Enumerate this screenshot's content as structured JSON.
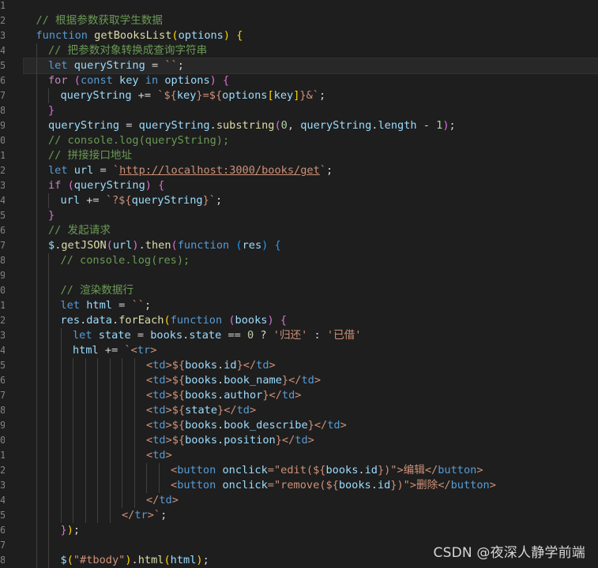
{
  "line_numbers": [
    "1",
    "2",
    "3",
    "4",
    "5",
    "6",
    "7",
    "8",
    "9",
    "0",
    "1",
    "2",
    "3",
    "4",
    "5",
    "6",
    "7",
    "8",
    "9",
    "0",
    "1",
    "2",
    "3",
    "4",
    "5",
    "6",
    "7",
    "8",
    "9",
    "0",
    "1",
    "2",
    "3",
    "4",
    "5",
    "6",
    "7",
    "8"
  ],
  "code_lines": [
    {
      "indent": 0,
      "tokens": []
    },
    {
      "indent": 1,
      "tokens": [
        {
          "t": "// 根据参数获取学生数据",
          "c": "cm"
        }
      ]
    },
    {
      "indent": 1,
      "tokens": [
        {
          "t": "function ",
          "c": "k"
        },
        {
          "t": "getBooksList",
          "c": "f"
        },
        {
          "t": "(",
          "c": "b1"
        },
        {
          "t": "options",
          "c": "v"
        },
        {
          "t": ") ",
          "c": "b1"
        },
        {
          "t": "{",
          "c": "b1"
        }
      ]
    },
    {
      "indent": 2,
      "tokens": [
        {
          "t": "// 把参数对象转换成查询字符串",
          "c": "cm"
        }
      ]
    },
    {
      "indent": 2,
      "tokens": [
        {
          "t": "let ",
          "c": "k"
        },
        {
          "t": "queryString",
          "c": "v"
        },
        {
          "t": " = ",
          "c": "p"
        },
        {
          "t": "``",
          "c": "s"
        },
        {
          "t": ";",
          "c": "p"
        }
      ],
      "current": true
    },
    {
      "indent": 2,
      "tokens": [
        {
          "t": "for ",
          "c": "c"
        },
        {
          "t": "(",
          "c": "b2"
        },
        {
          "t": "const ",
          "c": "k"
        },
        {
          "t": "key ",
          "c": "v"
        },
        {
          "t": "in ",
          "c": "k"
        },
        {
          "t": "options",
          "c": "v"
        },
        {
          "t": ") ",
          "c": "b2"
        },
        {
          "t": "{",
          "c": "b2"
        }
      ]
    },
    {
      "indent": 3,
      "tokens": [
        {
          "t": "queryString",
          "c": "v"
        },
        {
          "t": " += ",
          "c": "p"
        },
        {
          "t": "`${",
          "c": "s"
        },
        {
          "t": "key",
          "c": "v"
        },
        {
          "t": "}=${",
          "c": "s"
        },
        {
          "t": "options",
          "c": "v"
        },
        {
          "t": "[",
          "c": "b1"
        },
        {
          "t": "key",
          "c": "v"
        },
        {
          "t": "]",
          "c": "b1"
        },
        {
          "t": "}&`",
          "c": "s"
        },
        {
          "t": ";",
          "c": "p"
        }
      ]
    },
    {
      "indent": 2,
      "tokens": [
        {
          "t": "}",
          "c": "b2"
        }
      ]
    },
    {
      "indent": 2,
      "tokens": [
        {
          "t": "queryString",
          "c": "v"
        },
        {
          "t": " = ",
          "c": "p"
        },
        {
          "t": "queryString",
          "c": "v"
        },
        {
          "t": ".",
          "c": "p"
        },
        {
          "t": "substring",
          "c": "f"
        },
        {
          "t": "(",
          "c": "b2"
        },
        {
          "t": "0",
          "c": "n"
        },
        {
          "t": ", ",
          "c": "p"
        },
        {
          "t": "queryString",
          "c": "v"
        },
        {
          "t": ".",
          "c": "p"
        },
        {
          "t": "length",
          "c": "v"
        },
        {
          "t": " - ",
          "c": "p"
        },
        {
          "t": "1",
          "c": "n"
        },
        {
          "t": ")",
          "c": "b2"
        },
        {
          "t": ";",
          "c": "p"
        }
      ]
    },
    {
      "indent": 2,
      "tokens": [
        {
          "t": "// console.log(queryString);",
          "c": "cm"
        }
      ]
    },
    {
      "indent": 2,
      "tokens": [
        {
          "t": "// 拼接接口地址",
          "c": "cm"
        }
      ]
    },
    {
      "indent": 2,
      "tokens": [
        {
          "t": "let ",
          "c": "k"
        },
        {
          "t": "url",
          "c": "v"
        },
        {
          "t": " = ",
          "c": "p"
        },
        {
          "t": "`",
          "c": "s"
        },
        {
          "t": "http://localhost:3000/books/get",
          "c": "url"
        },
        {
          "t": "`",
          "c": "s"
        },
        {
          "t": ";",
          "c": "p"
        }
      ]
    },
    {
      "indent": 2,
      "tokens": [
        {
          "t": "if ",
          "c": "c"
        },
        {
          "t": "(",
          "c": "b2"
        },
        {
          "t": "queryString",
          "c": "v"
        },
        {
          "t": ") ",
          "c": "b2"
        },
        {
          "t": "{",
          "c": "b2"
        }
      ]
    },
    {
      "indent": 3,
      "tokens": [
        {
          "t": "url",
          "c": "v"
        },
        {
          "t": " += ",
          "c": "p"
        },
        {
          "t": "`?${",
          "c": "s"
        },
        {
          "t": "queryString",
          "c": "v"
        },
        {
          "t": "}`",
          "c": "s"
        },
        {
          "t": ";",
          "c": "p"
        }
      ]
    },
    {
      "indent": 2,
      "tokens": [
        {
          "t": "}",
          "c": "b2"
        }
      ]
    },
    {
      "indent": 2,
      "tokens": [
        {
          "t": "// 发起请求",
          "c": "cm"
        }
      ]
    },
    {
      "indent": 2,
      "tokens": [
        {
          "t": "$",
          "c": "v"
        },
        {
          "t": ".",
          "c": "p"
        },
        {
          "t": "getJSON",
          "c": "f"
        },
        {
          "t": "(",
          "c": "b2"
        },
        {
          "t": "url",
          "c": "v"
        },
        {
          "t": ")",
          "c": "b2"
        },
        {
          "t": ".",
          "c": "p"
        },
        {
          "t": "then",
          "c": "f"
        },
        {
          "t": "(",
          "c": "b2"
        },
        {
          "t": "function ",
          "c": "k"
        },
        {
          "t": "(",
          "c": "b3"
        },
        {
          "t": "res",
          "c": "v"
        },
        {
          "t": ") ",
          "c": "b3"
        },
        {
          "t": "{",
          "c": "b3"
        }
      ]
    },
    {
      "indent": 3,
      "tokens": [
        {
          "t": "// console.log(res);",
          "c": "cm"
        }
      ]
    },
    {
      "indent": 3,
      "tokens": []
    },
    {
      "indent": 3,
      "tokens": [
        {
          "t": "// 渲染数据行",
          "c": "cm"
        }
      ]
    },
    {
      "indent": 3,
      "tokens": [
        {
          "t": "let ",
          "c": "k"
        },
        {
          "t": "html",
          "c": "v"
        },
        {
          "t": " = ",
          "c": "p"
        },
        {
          "t": "``",
          "c": "s"
        },
        {
          "t": ";",
          "c": "p"
        }
      ]
    },
    {
      "indent": 3,
      "tokens": [
        {
          "t": "res",
          "c": "v"
        },
        {
          "t": ".",
          "c": "p"
        },
        {
          "t": "data",
          "c": "v"
        },
        {
          "t": ".",
          "c": "p"
        },
        {
          "t": "forEach",
          "c": "f"
        },
        {
          "t": "(",
          "c": "b1"
        },
        {
          "t": "function ",
          "c": "k"
        },
        {
          "t": "(",
          "c": "b2"
        },
        {
          "t": "books",
          "c": "v"
        },
        {
          "t": ") ",
          "c": "b2"
        },
        {
          "t": "{",
          "c": "b2"
        }
      ]
    },
    {
      "indent": 4,
      "tokens": [
        {
          "t": "let ",
          "c": "k"
        },
        {
          "t": "state",
          "c": "v"
        },
        {
          "t": " = ",
          "c": "p"
        },
        {
          "t": "books",
          "c": "v"
        },
        {
          "t": ".",
          "c": "p"
        },
        {
          "t": "state",
          "c": "v"
        },
        {
          "t": " == ",
          "c": "p"
        },
        {
          "t": "0",
          "c": "n"
        },
        {
          "t": " ? ",
          "c": "p"
        },
        {
          "t": "'归还'",
          "c": "s"
        },
        {
          "t": " : ",
          "c": "p"
        },
        {
          "t": "'已借'",
          "c": "s"
        }
      ]
    },
    {
      "indent": 4,
      "tokens": [
        {
          "t": "html",
          "c": "v"
        },
        {
          "t": " += ",
          "c": "p"
        },
        {
          "t": "`<",
          "c": "s"
        },
        {
          "t": "tr",
          "c": "tg"
        },
        {
          "t": ">",
          "c": "s"
        }
      ]
    },
    {
      "indent": 10,
      "tokens": [
        {
          "t": "<",
          "c": "s"
        },
        {
          "t": "td",
          "c": "tg"
        },
        {
          "t": ">${",
          "c": "s"
        },
        {
          "t": "books",
          "c": "v"
        },
        {
          "t": ".",
          "c": "p"
        },
        {
          "t": "id",
          "c": "v"
        },
        {
          "t": "}</",
          "c": "s"
        },
        {
          "t": "td",
          "c": "tg"
        },
        {
          "t": ">",
          "c": "s"
        }
      ]
    },
    {
      "indent": 10,
      "tokens": [
        {
          "t": "<",
          "c": "s"
        },
        {
          "t": "td",
          "c": "tg"
        },
        {
          "t": ">${",
          "c": "s"
        },
        {
          "t": "books",
          "c": "v"
        },
        {
          "t": ".",
          "c": "p"
        },
        {
          "t": "book_name",
          "c": "v"
        },
        {
          "t": "}</",
          "c": "s"
        },
        {
          "t": "td",
          "c": "tg"
        },
        {
          "t": ">",
          "c": "s"
        }
      ]
    },
    {
      "indent": 10,
      "tokens": [
        {
          "t": "<",
          "c": "s"
        },
        {
          "t": "td",
          "c": "tg"
        },
        {
          "t": ">${",
          "c": "s"
        },
        {
          "t": "books",
          "c": "v"
        },
        {
          "t": ".",
          "c": "p"
        },
        {
          "t": "author",
          "c": "v"
        },
        {
          "t": "}</",
          "c": "s"
        },
        {
          "t": "td",
          "c": "tg"
        },
        {
          "t": ">",
          "c": "s"
        }
      ]
    },
    {
      "indent": 10,
      "tokens": [
        {
          "t": "<",
          "c": "s"
        },
        {
          "t": "td",
          "c": "tg"
        },
        {
          "t": ">${",
          "c": "s"
        },
        {
          "t": "state",
          "c": "v"
        },
        {
          "t": "}</",
          "c": "s"
        },
        {
          "t": "td",
          "c": "tg"
        },
        {
          "t": ">",
          "c": "s"
        }
      ]
    },
    {
      "indent": 10,
      "tokens": [
        {
          "t": "<",
          "c": "s"
        },
        {
          "t": "td",
          "c": "tg"
        },
        {
          "t": ">${",
          "c": "s"
        },
        {
          "t": "books",
          "c": "v"
        },
        {
          "t": ".",
          "c": "p"
        },
        {
          "t": "book_describe",
          "c": "v"
        },
        {
          "t": "}</",
          "c": "s"
        },
        {
          "t": "td",
          "c": "tg"
        },
        {
          "t": ">",
          "c": "s"
        }
      ]
    },
    {
      "indent": 10,
      "tokens": [
        {
          "t": "<",
          "c": "s"
        },
        {
          "t": "td",
          "c": "tg"
        },
        {
          "t": ">${",
          "c": "s"
        },
        {
          "t": "books",
          "c": "v"
        },
        {
          "t": ".",
          "c": "p"
        },
        {
          "t": "position",
          "c": "v"
        },
        {
          "t": "}</",
          "c": "s"
        },
        {
          "t": "td",
          "c": "tg"
        },
        {
          "t": ">",
          "c": "s"
        }
      ]
    },
    {
      "indent": 10,
      "tokens": [
        {
          "t": "<",
          "c": "s"
        },
        {
          "t": "td",
          "c": "tg"
        },
        {
          "t": ">",
          "c": "s"
        }
      ]
    },
    {
      "indent": 12,
      "tokens": [
        {
          "t": "<",
          "c": "s"
        },
        {
          "t": "button ",
          "c": "tg"
        },
        {
          "t": "onclick",
          "c": "at"
        },
        {
          "t": "=\"edit(${",
          "c": "s"
        },
        {
          "t": "books",
          "c": "v"
        },
        {
          "t": ".",
          "c": "p"
        },
        {
          "t": "id",
          "c": "v"
        },
        {
          "t": "})\">编辑</",
          "c": "s"
        },
        {
          "t": "button",
          "c": "tg"
        },
        {
          "t": ">",
          "c": "s"
        }
      ]
    },
    {
      "indent": 12,
      "tokens": [
        {
          "t": "<",
          "c": "s"
        },
        {
          "t": "button ",
          "c": "tg"
        },
        {
          "t": "onclick",
          "c": "at"
        },
        {
          "t": "=\"remove(${",
          "c": "s"
        },
        {
          "t": "books",
          "c": "v"
        },
        {
          "t": ".",
          "c": "p"
        },
        {
          "t": "id",
          "c": "v"
        },
        {
          "t": "})\">删除</",
          "c": "s"
        },
        {
          "t": "button",
          "c": "tg"
        },
        {
          "t": ">",
          "c": "s"
        }
      ]
    },
    {
      "indent": 10,
      "tokens": [
        {
          "t": "</",
          "c": "s"
        },
        {
          "t": "td",
          "c": "tg"
        },
        {
          "t": ">",
          "c": "s"
        }
      ]
    },
    {
      "indent": 8,
      "tokens": [
        {
          "t": "</",
          "c": "s"
        },
        {
          "t": "tr",
          "c": "tg"
        },
        {
          "t": ">`",
          "c": "s"
        },
        {
          "t": ";",
          "c": "p"
        }
      ]
    },
    {
      "indent": 3,
      "tokens": [
        {
          "t": "}",
          "c": "b2"
        },
        {
          "t": ")",
          "c": "b1"
        },
        {
          "t": ";",
          "c": "p"
        }
      ]
    },
    {
      "indent": 3,
      "tokens": []
    },
    {
      "indent": 3,
      "tokens": [
        {
          "t": "$",
          "c": "v"
        },
        {
          "t": "(",
          "c": "b1"
        },
        {
          "t": "\"#tbody\"",
          "c": "s"
        },
        {
          "t": ")",
          "c": "b1"
        },
        {
          "t": ".",
          "c": "p"
        },
        {
          "t": "html",
          "c": "f"
        },
        {
          "t": "(",
          "c": "b1"
        },
        {
          "t": "html",
          "c": "v"
        },
        {
          "t": ")",
          "c": "b1"
        },
        {
          "t": ";",
          "c": "p"
        }
      ]
    }
  ],
  "watermark": "CSDN @夜深人静学前端"
}
